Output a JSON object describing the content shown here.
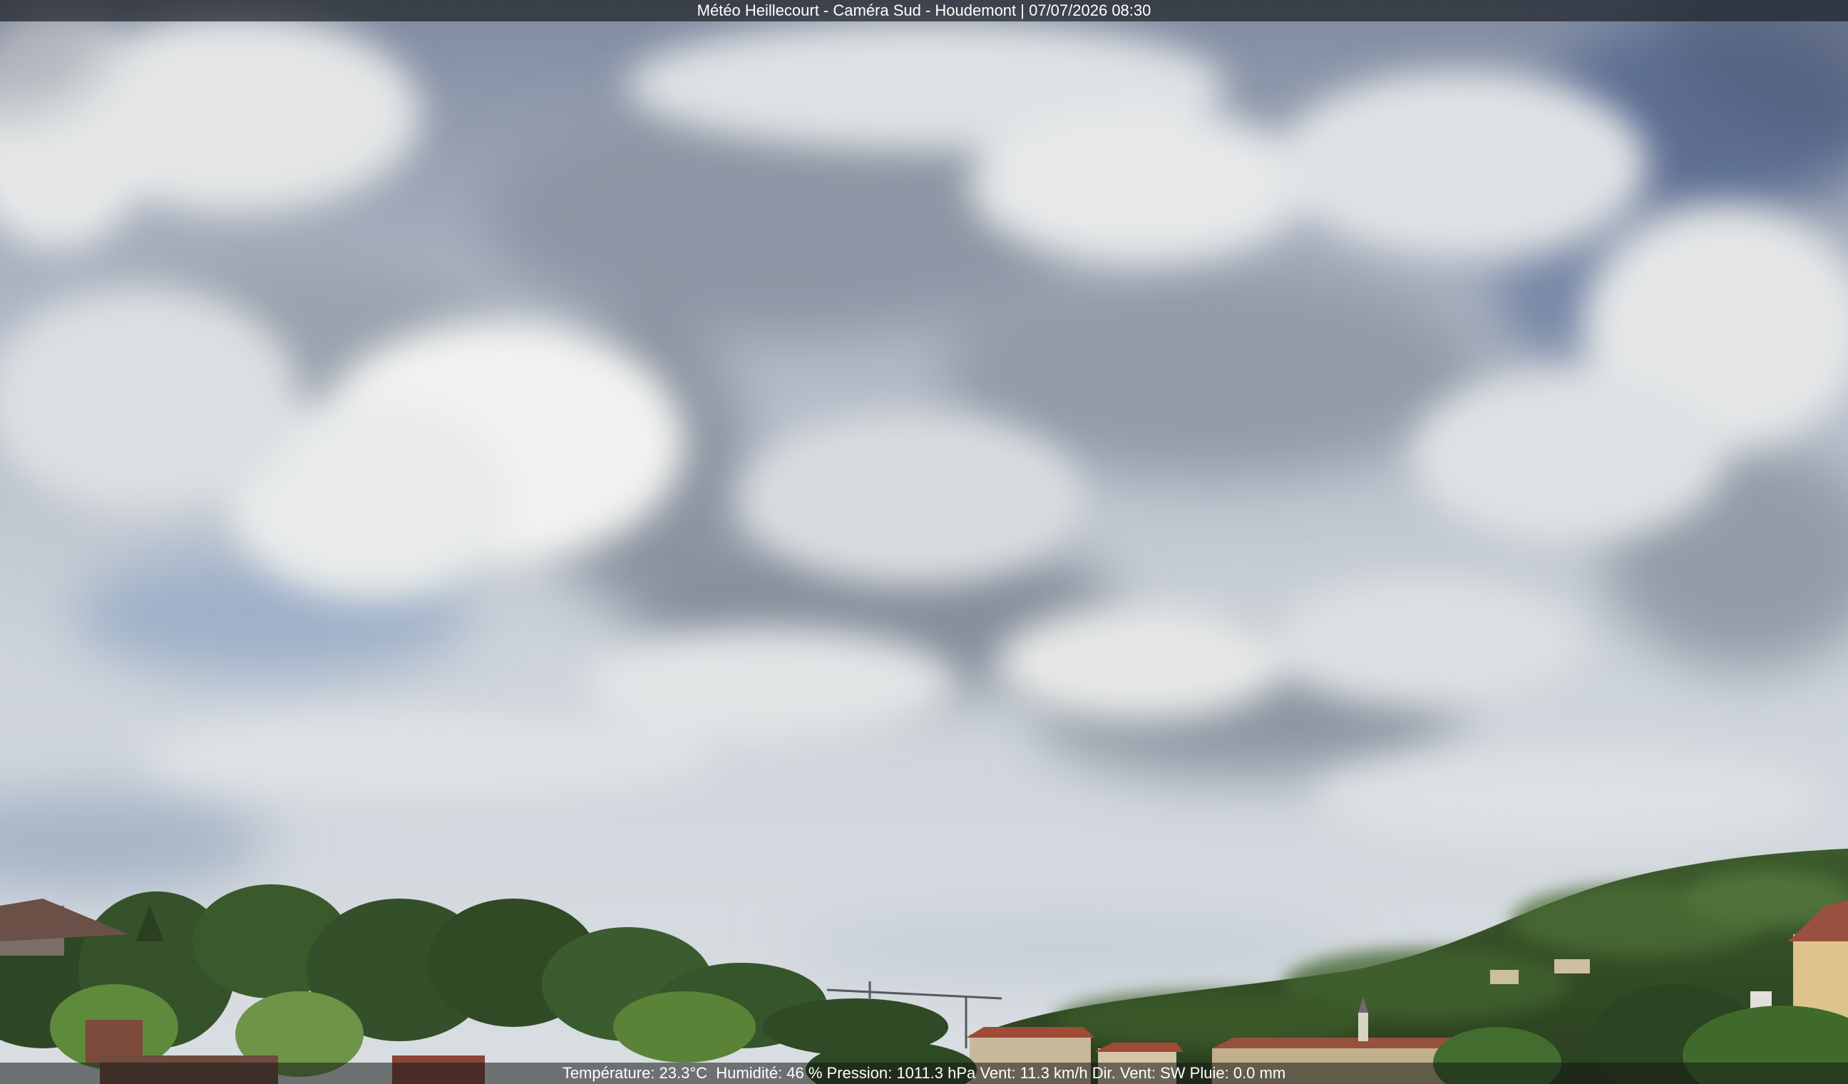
{
  "overlay": {
    "title": "Météo Heillecourt - Caméra Sud - Houdemont | 07/07/2026 08:30",
    "weather_line": "Température: 23.3°C  Humidité: 46 % Pression: 1011.3 hPa Vent: 11.3 km/h Dir. Vent: SW Pluie: 0.0 mm"
  },
  "colors": {
    "sky_top": "#6d7a92",
    "cloud_white": "#eef0f0",
    "cloud_grey": "#9aa2ad",
    "tree_dark": "#2f4a22",
    "tree_light": "#5e8a3c",
    "roof_red": "#9c4a38"
  }
}
